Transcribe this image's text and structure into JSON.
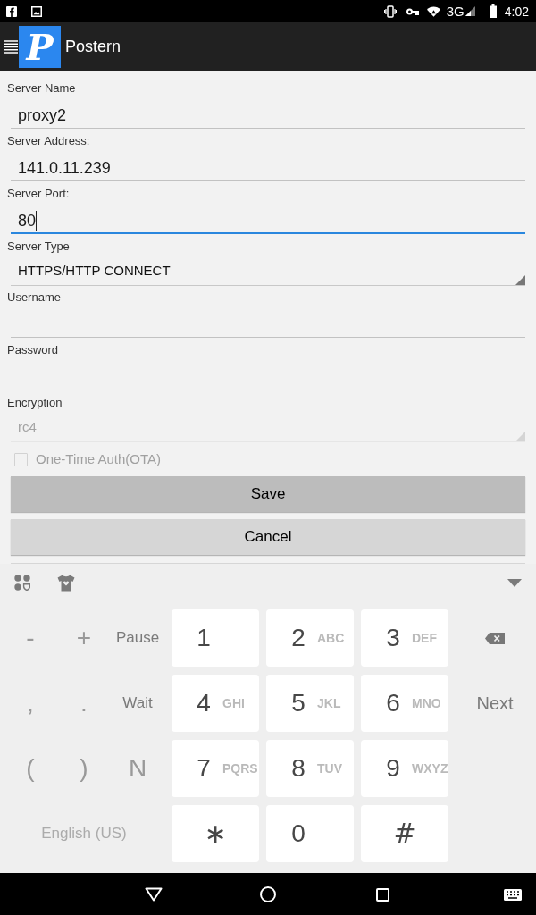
{
  "status_bar": {
    "network": "3G",
    "time": "4:02"
  },
  "app_bar": {
    "logo": "P",
    "title": "Postern"
  },
  "form": {
    "fields": [
      {
        "kind": "text",
        "label": "Server Name",
        "value": "proxy2",
        "focused": false,
        "disabled": false
      },
      {
        "kind": "text",
        "label": "Server Address:",
        "value": "141.0.11.239",
        "focused": false,
        "disabled": false
      },
      {
        "kind": "text",
        "label": "Server Port:",
        "value": "80",
        "focused": true,
        "disabled": false
      },
      {
        "kind": "dropdown",
        "label": "Server Type",
        "value": "HTTPS/HTTP CONNECT",
        "focused": false,
        "disabled": false
      },
      {
        "kind": "text",
        "label": "Username",
        "focused": false,
        "disabled": false
      },
      {
        "kind": "text",
        "label": "Password",
        "focused": false,
        "disabled": false
      },
      {
        "kind": "dropdown",
        "label": "Encryption",
        "value": "rc4",
        "focused": false,
        "disabled": true
      }
    ],
    "checkbox": {
      "label": "One-Time Auth(OTA)",
      "checked": false,
      "disabled": true
    },
    "buttons": [
      {
        "label": "Save",
        "highlighted": true
      },
      {
        "label": "Cancel",
        "highlighted": false
      }
    ]
  },
  "keyboard": {
    "side_keys": [
      [
        {
          "kind": "symbol",
          "label": "-"
        },
        {
          "kind": "symbol",
          "label": "+"
        },
        {
          "kind": "action",
          "label": "Pause"
        }
      ],
      [
        {
          "kind": "symbol",
          "label": ","
        },
        {
          "kind": "symbol",
          "label": "."
        },
        {
          "kind": "action",
          "label": "Wait"
        }
      ],
      [
        {
          "kind": "symbol",
          "label": "("
        },
        {
          "kind": "symbol",
          "label": ")"
        },
        {
          "kind": "symbol",
          "label": "N"
        }
      ]
    ],
    "language": "English (US)",
    "keypad": [
      [
        {
          "kind": "digit",
          "label": "1"
        },
        {
          "kind": "digit",
          "label": "2",
          "letters": "ABC"
        },
        {
          "kind": "digit",
          "label": "3",
          "letters": "DEF"
        }
      ],
      [
        {
          "kind": "digit",
          "label": "4",
          "letters": "GHI"
        },
        {
          "kind": "digit",
          "label": "5",
          "letters": "JKL"
        },
        {
          "kind": "digit",
          "label": "6",
          "letters": "MNO"
        }
      ],
      [
        {
          "kind": "digit",
          "label": "7",
          "letters": "PQRS"
        },
        {
          "kind": "digit",
          "label": "8",
          "letters": "TUV"
        },
        {
          "kind": "digit",
          "label": "9",
          "letters": "WXYZ"
        }
      ],
      [
        {
          "kind": "key",
          "label": "∗"
        },
        {
          "kind": "digit",
          "label": "0"
        },
        {
          "kind": "key",
          "label": "#"
        }
      ]
    ],
    "right_keys": [
      {
        "kind": "backspace"
      },
      {
        "kind": "action",
        "label": "Next"
      }
    ]
  }
}
